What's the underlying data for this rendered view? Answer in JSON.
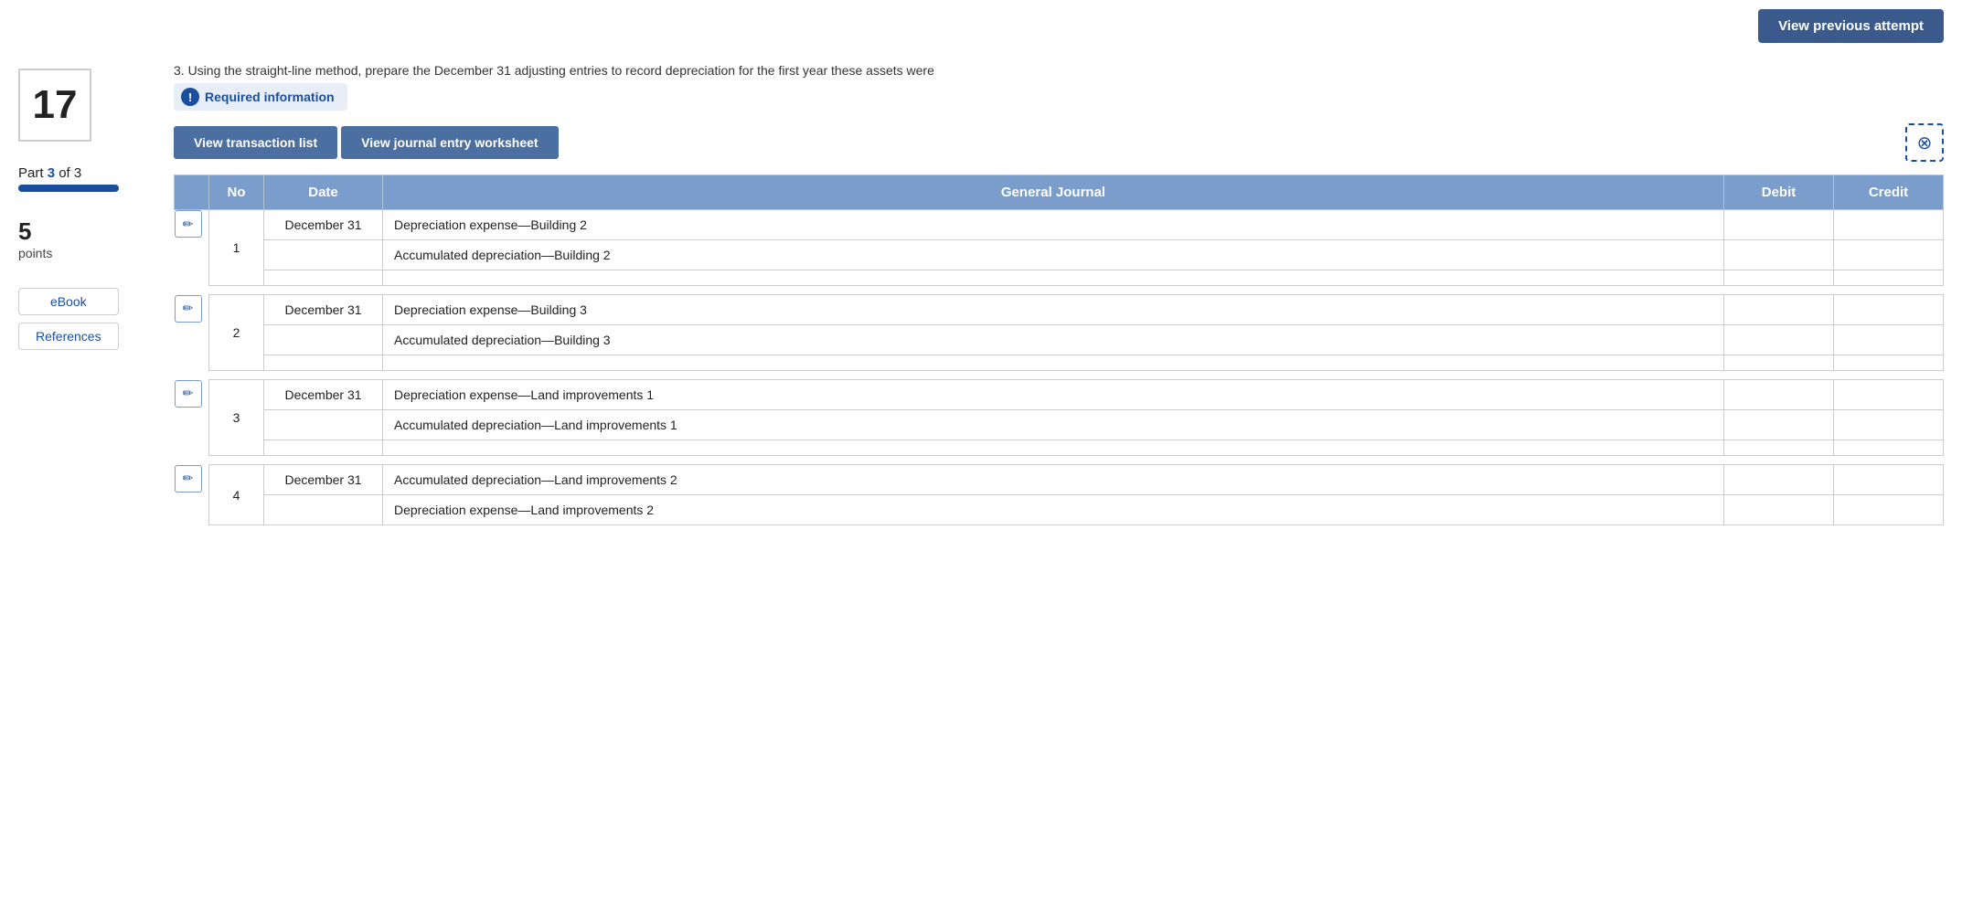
{
  "topBar": {
    "viewPreviousLabel": "View previous attempt"
  },
  "sidebar": {
    "questionNumber": "17",
    "partLabel": "Part",
    "partNumber": "3",
    "partOf": "3",
    "points": "5",
    "pointsLabel": "points",
    "ebookLabel": "eBook",
    "referencesLabel": "References"
  },
  "content": {
    "questionText": "3. Using the straight-line method, prepare the December 31 adjusting entries to record depreciation for the first year these assets were",
    "requiredInfo": "Required information",
    "viewTransactionList": "View transaction list",
    "viewJournalEntryWorksheet": "View journal entry worksheet",
    "closeIcon": "⊗",
    "table": {
      "headers": [
        "No",
        "Date",
        "General Journal",
        "Debit",
        "Credit"
      ],
      "entries": [
        {
          "no": "1",
          "rows": [
            {
              "date": "December 31",
              "description": "Depreciation expense—Building 2",
              "debit": "",
              "credit": ""
            },
            {
              "date": "",
              "description": "Accumulated depreciation—Building 2",
              "debit": "",
              "credit": ""
            },
            {
              "date": "",
              "description": "",
              "debit": "",
              "credit": ""
            }
          ]
        },
        {
          "no": "2",
          "rows": [
            {
              "date": "December 31",
              "description": "Depreciation expense—Building 3",
              "debit": "",
              "credit": ""
            },
            {
              "date": "",
              "description": "Accumulated depreciation—Building 3",
              "debit": "",
              "credit": ""
            },
            {
              "date": "",
              "description": "",
              "debit": "",
              "credit": ""
            }
          ]
        },
        {
          "no": "3",
          "rows": [
            {
              "date": "December 31",
              "description": "Depreciation expense—Land improvements 1",
              "debit": "",
              "credit": ""
            },
            {
              "date": "",
              "description": "Accumulated depreciation—Land improvements 1",
              "debit": "",
              "credit": ""
            },
            {
              "date": "",
              "description": "",
              "debit": "",
              "credit": ""
            }
          ]
        },
        {
          "no": "4",
          "rows": [
            {
              "date": "December 31",
              "description": "Accumulated depreciation—Land improvements 2",
              "debit": "",
              "credit": ""
            },
            {
              "date": "",
              "description": "Depreciation expense—Land improvements 2",
              "debit": "",
              "credit": ""
            }
          ]
        }
      ]
    }
  }
}
